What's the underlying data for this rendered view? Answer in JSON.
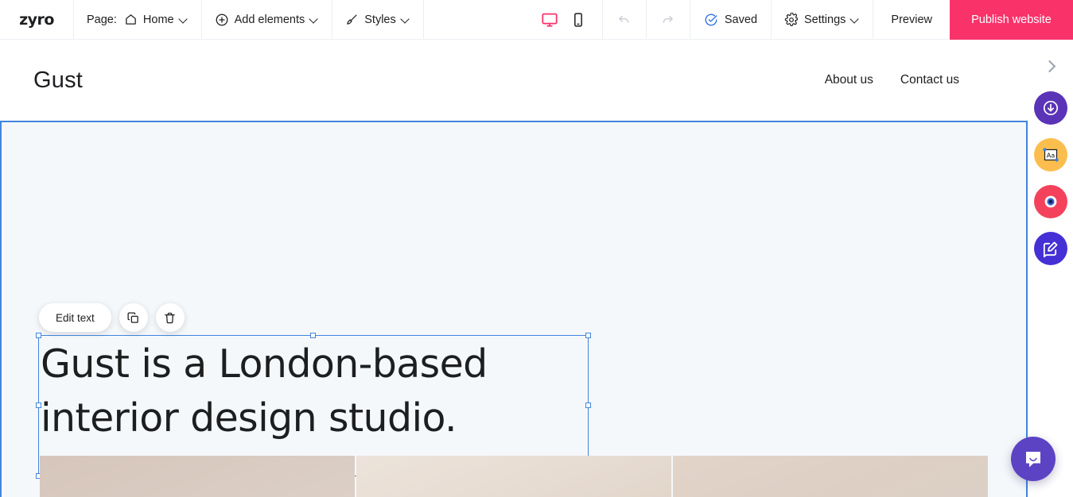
{
  "app": {
    "name": "zyro",
    "logo_text": "zyro"
  },
  "toolbar": {
    "page_label": "Page:",
    "page_name": "Home",
    "page_icon": "home-icon",
    "add_elements_label": "Add elements",
    "add_elements_icon": "plus-circle-icon",
    "styles_label": "Styles",
    "styles_icon": "brush-icon",
    "devices": [
      {
        "name": "desktop",
        "icon": "monitor-icon",
        "active": true,
        "color": "#f9326a"
      },
      {
        "name": "mobile",
        "icon": "phone-icon",
        "active": false,
        "color": "#1d1e20"
      }
    ],
    "undo": {
      "icon": "undo-arrow-icon",
      "enabled": false
    },
    "redo": {
      "icon": "redo-arrow-icon",
      "enabled": false
    },
    "saved_label": "Saved",
    "saved_icon": "check-circle-icon",
    "saved_icon_color": "#2f6fe4",
    "settings_label": "Settings",
    "settings_icon": "gear-icon",
    "preview_label": "Preview",
    "publish_label": "Publish website",
    "publish_color": "#f9326a"
  },
  "site": {
    "brand": "Gust",
    "nav": [
      {
        "label": "About us"
      },
      {
        "label": "Contact us"
      }
    ],
    "headline": "Gust is a London-based interior design studio.",
    "section_background": "#f5f8fb",
    "selection_color": "#4285dd"
  },
  "element_toolbar": {
    "edit_label": "Edit text",
    "duplicate_icon": "duplicate-icon",
    "delete_icon": "trash-icon"
  },
  "right_rail": {
    "collapse_icon": "chevron-right-icon",
    "buttons": [
      {
        "name": "add-section",
        "icon": "download-circle-icon",
        "color": "#5b33b7"
      },
      {
        "name": "edit-text",
        "icon": "text-aa-icon",
        "color": "#fbbe4e"
      },
      {
        "name": "preview-eye",
        "icon": "eye-icon",
        "color": "#f4425c"
      },
      {
        "name": "blog-editor",
        "icon": "pencil-square-icon",
        "color": "#4530d6"
      }
    ]
  },
  "chat": {
    "icon": "chat-bubble-icon",
    "color": "#5b43c4"
  },
  "gallery": {
    "tiles": [
      {
        "name": "image-tile-1"
      },
      {
        "name": "image-tile-2"
      },
      {
        "name": "image-tile-3"
      }
    ]
  }
}
